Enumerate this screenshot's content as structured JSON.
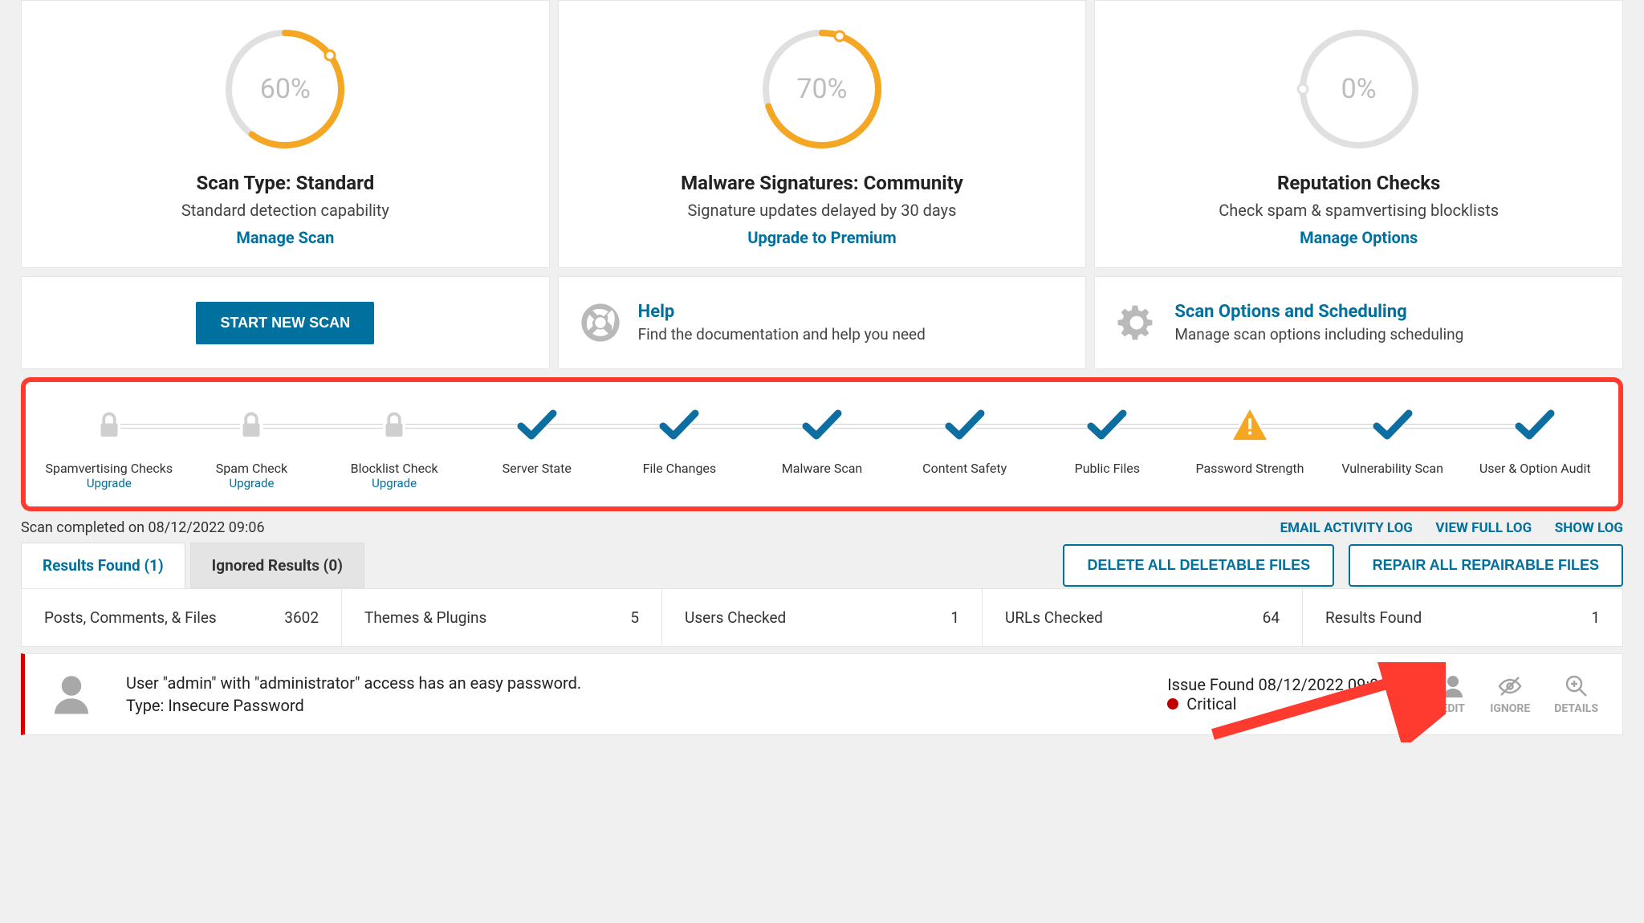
{
  "cards": [
    {
      "percent": 60,
      "label": "60%",
      "title": "Scan Type: Standard",
      "sub": "Standard detection capability",
      "link": "Manage Scan"
    },
    {
      "percent": 70,
      "label": "70%",
      "title": "Malware Signatures: Community",
      "sub": "Signature updates delayed by 30 days",
      "link": "Upgrade to Premium"
    },
    {
      "percent": 0,
      "label": "0%",
      "title": "Reputation Checks",
      "sub": "Check spam & spamvertising blocklists",
      "link": "Manage Options"
    }
  ],
  "actions": {
    "scan_button": "START NEW SCAN",
    "help": {
      "title": "Help",
      "sub": "Find the documentation and help you need"
    },
    "options": {
      "title": "Scan Options and Scheduling",
      "sub": "Manage scan options including scheduling"
    }
  },
  "steps": [
    {
      "label": "Spamvertising Checks",
      "status": "lock",
      "sublink": "Upgrade"
    },
    {
      "label": "Spam Check",
      "status": "lock",
      "sublink": "Upgrade"
    },
    {
      "label": "Blocklist Check",
      "status": "lock",
      "sublink": "Upgrade"
    },
    {
      "label": "Server State",
      "status": "check"
    },
    {
      "label": "File Changes",
      "status": "check"
    },
    {
      "label": "Malware Scan",
      "status": "check"
    },
    {
      "label": "Content Safety",
      "status": "check"
    },
    {
      "label": "Public Files",
      "status": "check"
    },
    {
      "label": "Password Strength",
      "status": "warn"
    },
    {
      "label": "Vulnerability Scan",
      "status": "check"
    },
    {
      "label": "User & Option Audit",
      "status": "check"
    }
  ],
  "completed_text": "Scan completed on 08/12/2022 09:06",
  "logs": {
    "email": "EMAIL ACTIVITY LOG",
    "full": "VIEW FULL LOG",
    "show": "SHOW LOG"
  },
  "tabs": {
    "results": "Results Found (1)",
    "ignored": "Ignored Results (0)"
  },
  "bulk": {
    "delete": "DELETE ALL DELETABLE FILES",
    "repair": "REPAIR ALL REPAIRABLE FILES"
  },
  "stats": [
    {
      "label": "Posts, Comments, & Files",
      "value": "3602"
    },
    {
      "label": "Themes & Plugins",
      "value": "5"
    },
    {
      "label": "Users Checked",
      "value": "1"
    },
    {
      "label": "URLs Checked",
      "value": "64"
    },
    {
      "label": "Results Found",
      "value": "1"
    }
  ],
  "issue": {
    "desc": "User \"admin\" with \"administrator\" access has an easy password.",
    "type_line": "Type: Insecure Password",
    "found": "Issue Found 08/12/2022 09:06",
    "severity": "Critical",
    "edit": "EDIT",
    "ignore": "IGNORE",
    "details": "DETAILS"
  }
}
